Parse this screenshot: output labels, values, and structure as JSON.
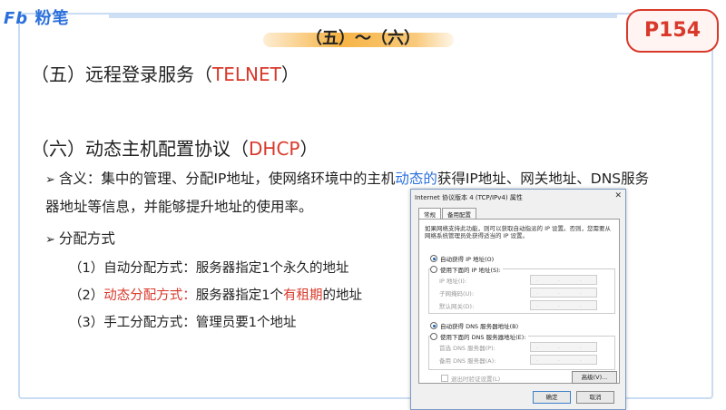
{
  "brand": {
    "logo_text": "粉笔",
    "logo_prefix": "Fb"
  },
  "header": {
    "title": "（五）～（六）",
    "page_badge": "P154"
  },
  "section5": {
    "prefix": "（五）远程登录服务（",
    "highlight": "TELNET",
    "suffix": "）"
  },
  "section6": {
    "prefix": "（六）动态主机配置协议（",
    "highlight": "DHCP",
    "suffix": "）",
    "meaning_bullet": "➢",
    "meaning_line1_a": "含义：集中的管理、分配IP地址，使网络环境中的主机",
    "meaning_line1_blue": "动态的",
    "meaning_line1_b": "获得IP地址、网关地址、DNS服务",
    "meaning_line2": "器地址等信息，并能够提升地址的使用率。",
    "methods_heading": "分配方式",
    "method1": "（1）自动分配方式：服务器指定1个永久的地址",
    "method2_prefix": "（2）",
    "method2_red": "动态分配方式：",
    "method2_mid": "服务器指定1个",
    "method2_red2": "有租期",
    "method2_suffix": "的地址",
    "method3": "（3）手工分配方式：管理员要1个地址"
  },
  "dialog": {
    "title": "Internet 协议版本 4 (TCP/IPv4) 属性",
    "close": "✕",
    "tabs": [
      "常规",
      "备用配置"
    ],
    "description": "如果网络支持此功能，则可以获取自动指派的 IP 设置。否则，您需要从网络系统管理员处获得适当的 IP 设置。",
    "ip_auto": "自动获得 IP 地址(O)",
    "ip_manual": "使用下面的 IP 地址(S):",
    "ip_label": "IP 地址(I):",
    "mask_label": "子网掩码(U):",
    "gateway_label": "默认网关(D):",
    "dns_auto": "自动获得 DNS 服务器地址(B)",
    "dns_manual": "使用下面的 DNS 服务器地址(E):",
    "dns_pref_label": "首选 DNS 服务器(P):",
    "dns_alt_label": "备用 DNS 服务器(A):",
    "ip_placeholder": ". . .",
    "validate_label": "退出时验证设置(L)",
    "advanced_label": "高级(V)...",
    "ok_label": "确定",
    "cancel_label": "取消"
  }
}
